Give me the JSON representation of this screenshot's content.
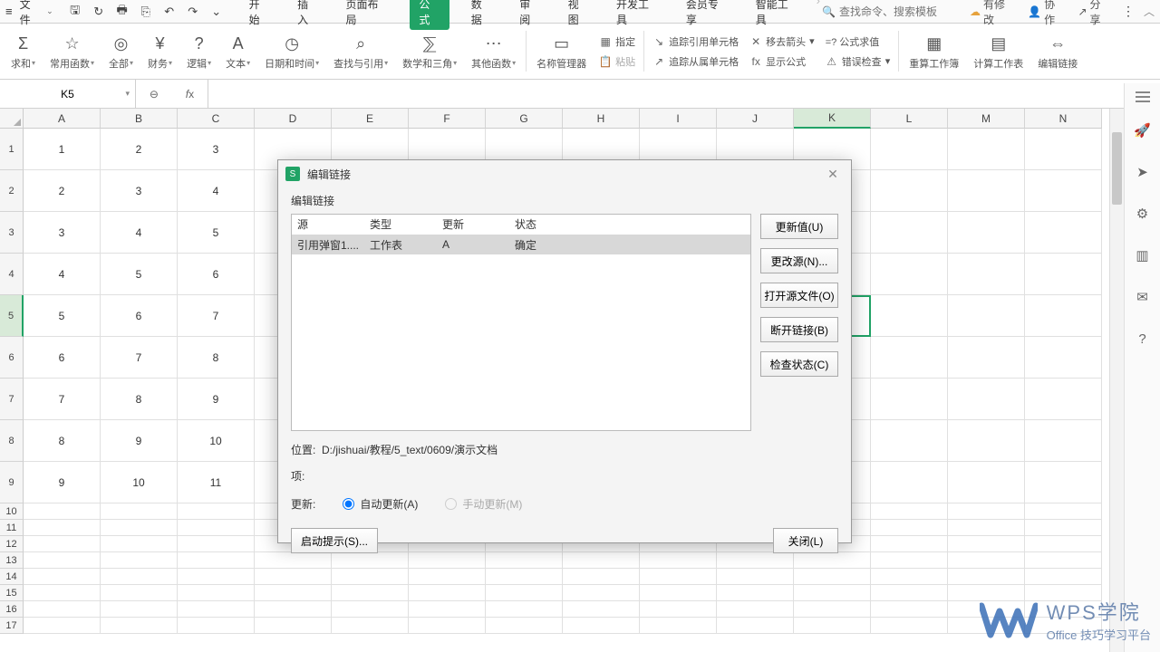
{
  "colors": {
    "accent": "#21a366"
  },
  "menubar": {
    "file": "文件",
    "tabs": [
      "开始",
      "插入",
      "页面布局",
      "公式",
      "数据",
      "审阅",
      "视图",
      "开发工具",
      "会员专享",
      "智能工具"
    ],
    "active_tab_index": 3,
    "search_placeholder": "查找命令、搜索模板",
    "right": {
      "changes": "有修改",
      "collab": "协作",
      "share": "分享"
    }
  },
  "ribbon": {
    "big": [
      {
        "icon": "Σ",
        "label": "求和"
      },
      {
        "icon": "☆",
        "label": "常用函数"
      },
      {
        "icon": "◎",
        "label": "全部"
      },
      {
        "icon": "¥",
        "label": "财务"
      },
      {
        "icon": "?",
        "label": "逻辑"
      },
      {
        "icon": "A",
        "label": "文本"
      },
      {
        "icon": "◷",
        "label": "日期和时间"
      },
      {
        "icon": "⌕",
        "label": "查找与引用"
      },
      {
        "icon": "⅀",
        "label": "数学和三角"
      },
      {
        "icon": "⋯",
        "label": "其他函数"
      }
    ],
    "name_mgr": "名称管理器",
    "col_a": {
      "assign": "指定",
      "paste": "粘贴"
    },
    "col_b": {
      "trace_prec": "追踪引用单元格",
      "trace_dep": "追踪从属单元格"
    },
    "col_c": {
      "remove_arrows": "移去箭头",
      "show_formula": "显示公式"
    },
    "col_d": {
      "eval": "=? 公式求值",
      "err_chk": "错误检查"
    },
    "big2": [
      {
        "icon": "▦",
        "label": "重算工作簿"
      },
      {
        "icon": "▤",
        "label": "计算工作表"
      },
      {
        "icon": "⇔",
        "label": "编辑链接"
      }
    ]
  },
  "fbar": {
    "cellref": "K5",
    "formula": ""
  },
  "columns": [
    "A",
    "B",
    "C",
    "D",
    "E",
    "F",
    "G",
    "H",
    "I",
    "J",
    "K",
    "L",
    "M",
    "N"
  ],
  "active_col_index": 10,
  "rows_tall": [
    1,
    2,
    3,
    4,
    5,
    6,
    7,
    8,
    9
  ],
  "rows_short": [
    10,
    11,
    12,
    13,
    14,
    15,
    16,
    17
  ],
  "active_row": 5,
  "cells": {
    "r1": [
      "1",
      "2",
      "3"
    ],
    "r2": [
      "2",
      "3",
      "4"
    ],
    "r3": [
      "3",
      "4",
      "5"
    ],
    "r4": [
      "4",
      "5",
      "6"
    ],
    "r5": [
      "5",
      "6",
      "7"
    ],
    "r6": [
      "6",
      "7",
      "8"
    ],
    "r7": [
      "7",
      "8",
      "9"
    ],
    "r8": [
      "8",
      "9",
      "10"
    ],
    "r9": [
      "9",
      "10",
      "11"
    ]
  },
  "dialog": {
    "title": "编辑链接",
    "subtitle": "编辑链接",
    "headers": {
      "src": "源",
      "type": "类型",
      "upd": "更新",
      "status": "状态"
    },
    "row": {
      "src": "引用弹窗1....",
      "type": "工作表",
      "upd": "A",
      "status": "确定"
    },
    "buttons": {
      "update": "更新值(U)",
      "change": "更改源(N)...",
      "open": "打开源文件(O)",
      "break": "断开链接(B)",
      "check": "检查状态(C)"
    },
    "loc_label": "位置:",
    "loc_value": "D:/jishuai/教程/5_text/0609/演示文档",
    "item_label": "项:",
    "upd_label": "更新:",
    "auto": "自动更新(A)",
    "manual": "手动更新(M)",
    "startup": "启动提示(S)...",
    "close": "关闭(L)"
  },
  "watermark": {
    "l1": "WPS学院",
    "l2": "Office 技巧学习平台"
  }
}
